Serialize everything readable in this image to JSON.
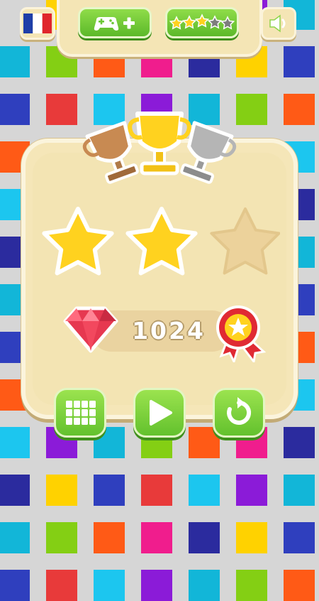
{
  "header": {
    "language_flag": "france-flag-icon",
    "add_game_button": "gamepad-plus-icon",
    "rate_button": "rating-stars-icon",
    "sound_button": "speaker-icon"
  },
  "result": {
    "trophies": [
      "bronze-trophy-icon",
      "gold-trophy-icon",
      "silver-trophy-icon"
    ],
    "stars_earned": 2,
    "stars_total": 3,
    "score": "1024",
    "gem_icon": "ruby-gem-icon",
    "badge_icon": "star-rosette-badge-icon"
  },
  "actions": {
    "menu_button": "grid-menu-icon",
    "play_button": "play-icon",
    "replay_button": "replay-icon"
  },
  "colors": {
    "panel": "#f5e6b8",
    "button_green": "#6cc836",
    "star_gold": "#ffd21f",
    "background": "#d6d6d6"
  }
}
